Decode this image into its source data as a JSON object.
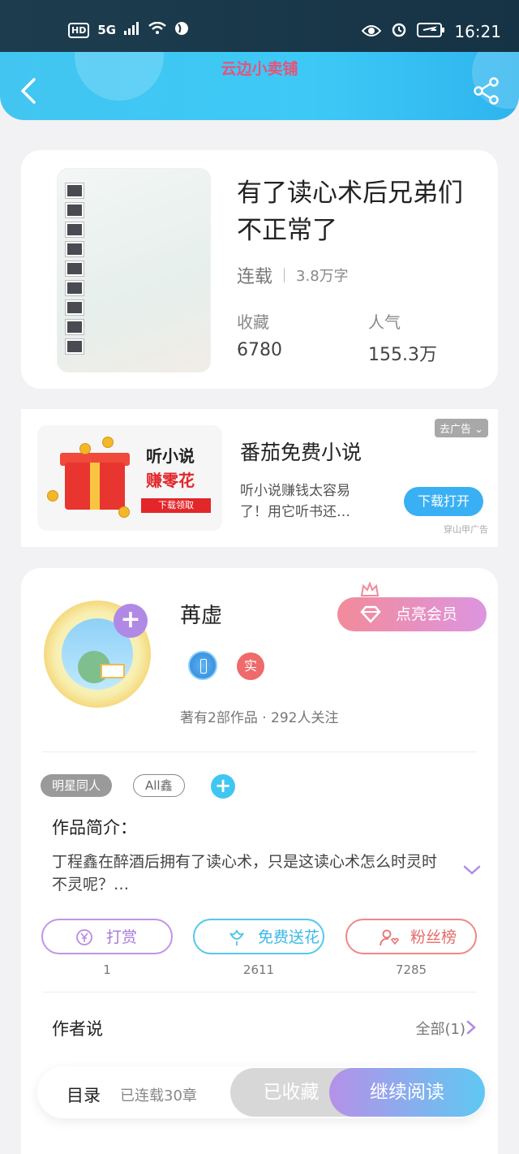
{
  "status_bar": {
    "hd": "HD",
    "net": "5G",
    "time": "16:21"
  },
  "header": {
    "title": "云边小卖铺"
  },
  "book": {
    "title": "有了读心术后兄弟们不正常了",
    "status": "连载",
    "word_count": "3.8万字",
    "favorites_label": "收藏",
    "favorites_value": "6780",
    "popularity_label": "人气",
    "popularity_value": "155.3万"
  },
  "ad": {
    "image_title": "听小说",
    "image_subtitle": "赚零花",
    "image_button": "下载领取",
    "tag": "去广告",
    "title": "番茄免费小说",
    "description": "听小说赚钱太容易了！用它听书还…",
    "button": "下载打开",
    "source": "穿山甲广告"
  },
  "author": {
    "name": "苒虚",
    "vip_button": "点亮会员",
    "real_badge": "实",
    "meta": "著有2部作品 · 292人关注"
  },
  "tags": [
    "明星同人",
    "All鑫"
  ],
  "intro": {
    "label": "作品简介：",
    "text": "丁程鑫在醉酒后拥有了读心术，只是这读心术怎么时灵时不灵呢？…"
  },
  "actions": [
    {
      "label": "打赏",
      "count": "1"
    },
    {
      "label": "免费送花",
      "count": "2611"
    },
    {
      "label": "粉丝榜",
      "count": "7285"
    }
  ],
  "author_says": {
    "label": "作者说",
    "all": "全部(1)"
  },
  "bottom_bar": {
    "toc": "目录",
    "chapters": "已连载30章",
    "collected": "已收藏",
    "continue": "继续阅读"
  },
  "colors": {
    "header": "#3dc9f6",
    "accent_purple": "#b089e6",
    "accent_blue": "#3fc7f2",
    "title_pink": "#e8527a"
  }
}
